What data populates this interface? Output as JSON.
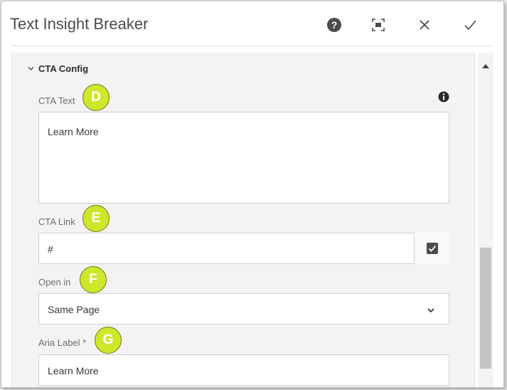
{
  "dialog": {
    "title": "Text Insight Breaker",
    "actions": {
      "help_icon": "help-icon",
      "fullscreen_icon": "fullscreen-icon",
      "close_icon": "close-icon",
      "done_icon": "checkmark-icon"
    }
  },
  "section": {
    "title": "CTA Config",
    "expanded": true
  },
  "fields": {
    "cta_text": {
      "label": "CTA Text",
      "value": "Learn  More",
      "badge": "D"
    },
    "cta_link": {
      "label": "CTA Link",
      "value": "#",
      "badge": "E"
    },
    "open_in": {
      "label": "Open in",
      "selected": "Same Page",
      "badge": "F"
    },
    "aria_label": {
      "label": "Aria Label *",
      "value": "Learn More",
      "badge": "G"
    }
  },
  "colors": {
    "badge_fill": "#cfe72b",
    "badge_border": "#6e7e12",
    "body_background": "#f3f3f3"
  },
  "scroll": {
    "position_fraction": 0.85
  }
}
